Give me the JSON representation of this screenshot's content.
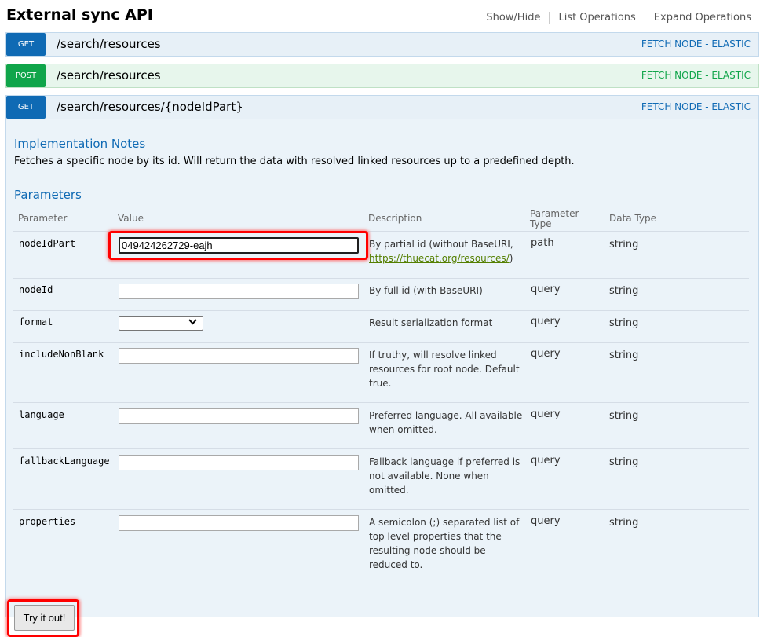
{
  "header": {
    "title": "External sync API",
    "links": [
      "Show/Hide",
      "List Operations",
      "Expand Operations"
    ]
  },
  "operations": [
    {
      "method": "GET",
      "path": "/search/resources",
      "tag": "FETCH NODE - ELASTIC"
    },
    {
      "method": "POST",
      "path": "/search/resources",
      "tag": "FETCH NODE - ELASTIC"
    },
    {
      "method": "GET",
      "path": "/search/resources/{nodeIdPart}",
      "tag": "FETCH NODE - ELASTIC"
    }
  ],
  "details": {
    "impl_heading": "Implementation Notes",
    "impl_text": "Fetches a specific node by its id. Will return the data with resolved linked resources up to a predefined depth.",
    "params_heading": "Parameters",
    "columns": {
      "parameter": "Parameter",
      "value": "Value",
      "description": "Description",
      "param_type_1": "Parameter",
      "param_type_2": "Type",
      "data_type": "Data Type"
    },
    "params": [
      {
        "name": "nodeIdPart",
        "value": "049424262729-eajh",
        "desc": "By partial id (without BaseURI,",
        "link": "https://thuecat.org/resources/",
        "desc_after": ")",
        "type": "path",
        "dtype": "string"
      },
      {
        "name": "nodeId",
        "value": "",
        "desc": "By full id (with BaseURI)",
        "type": "query",
        "dtype": "string"
      },
      {
        "name": "format",
        "value": "",
        "desc": "Result serialization format",
        "type": "query",
        "dtype": "string"
      },
      {
        "name": "includeNonBlank",
        "value": "",
        "desc_lines": [
          "If truthy, will resolve linked",
          "resources for root node. Default",
          "true."
        ],
        "type": "query",
        "dtype": "string"
      },
      {
        "name": "language",
        "value": "",
        "desc_lines": [
          "Preferred language. All available",
          "when omitted."
        ],
        "type": "query",
        "dtype": "string"
      },
      {
        "name": "fallbackLanguage",
        "value": "",
        "desc_lines": [
          "Fallback language if preferred is",
          "not available. None when",
          "omitted."
        ],
        "type": "query",
        "dtype": "string"
      },
      {
        "name": "properties",
        "value": "",
        "desc_lines": [
          "A semicolon (;) separated list of",
          "top level properties that the",
          "resulting node should be",
          "reduced to."
        ],
        "type": "query",
        "dtype": "string"
      }
    ],
    "try_button": "Try it out!"
  },
  "colors": {
    "get": "#0f6ab4",
    "post": "#10a54a",
    "highlight": "#ff0000"
  }
}
